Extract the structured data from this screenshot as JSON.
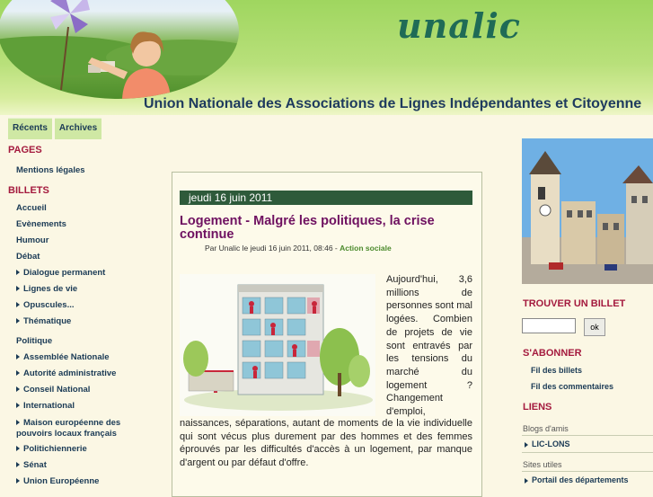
{
  "header": {
    "logo": "unalic",
    "subtitle": "Union Nationale des Associations de Lignes Indépendantes et Citoyenne"
  },
  "tabs": [
    "Récents",
    "Archives"
  ],
  "sidebar": {
    "pages_title": "PAGES",
    "pages": [
      "Mentions légales"
    ],
    "billets_title": "BILLETS",
    "billets": [
      "Accueil",
      "Evènements",
      "Humour",
      "Débat"
    ],
    "debat_sub": [
      "Dialogue permanent",
      "Lignes de vie",
      "Opuscules...",
      "Thématique"
    ],
    "politique_label": "Politique",
    "politique_sub": [
      "Assemblée Nationale",
      "Autorité administrative",
      "Conseil National",
      "International",
      "Maison européenne des pouvoirs locaux français",
      "Politichiennerie",
      "Sénat",
      "Union Européenne"
    ]
  },
  "post": {
    "date": "jeudi 16 juin 2011",
    "title": "Logement - Malgré les politiques, la crise continue",
    "meta_prefix": "Par Unalic le jeudi 16 juin 2011, 08:46 - ",
    "category": "Action sociale",
    "text_right": "Aujourd'hui, 3,6 millions de personnes sont mal logées. Combien de projets de vie sont entravés par les tensions du marché du logement ? Changement d'emploi,",
    "text_full": "naissances, séparations, autant de moments de la vie individuelle qui sont vécus plus durement par des hommes et des femmes éprouvés par les difficultés d'accès à un logement, par manque d'argent ou par défaut d'offre."
  },
  "right": {
    "search_title": "TROUVER UN BILLET",
    "search_button": "ok",
    "subscribe_title": "S'ABONNER",
    "feeds": [
      "Fil des billets",
      "Fil des commentaires"
    ],
    "links_title": "LIENS",
    "group1": "Blogs d'amis",
    "group1_links": [
      "LIC-LONS"
    ],
    "group2": "Sites utiles",
    "group2_links": [
      "Portail des départements"
    ]
  },
  "colors": {
    "accent": "#a41a3e",
    "title": "#6e1060",
    "date_bar": "#2e5a3a",
    "tab_bg": "#cfe8a4"
  }
}
